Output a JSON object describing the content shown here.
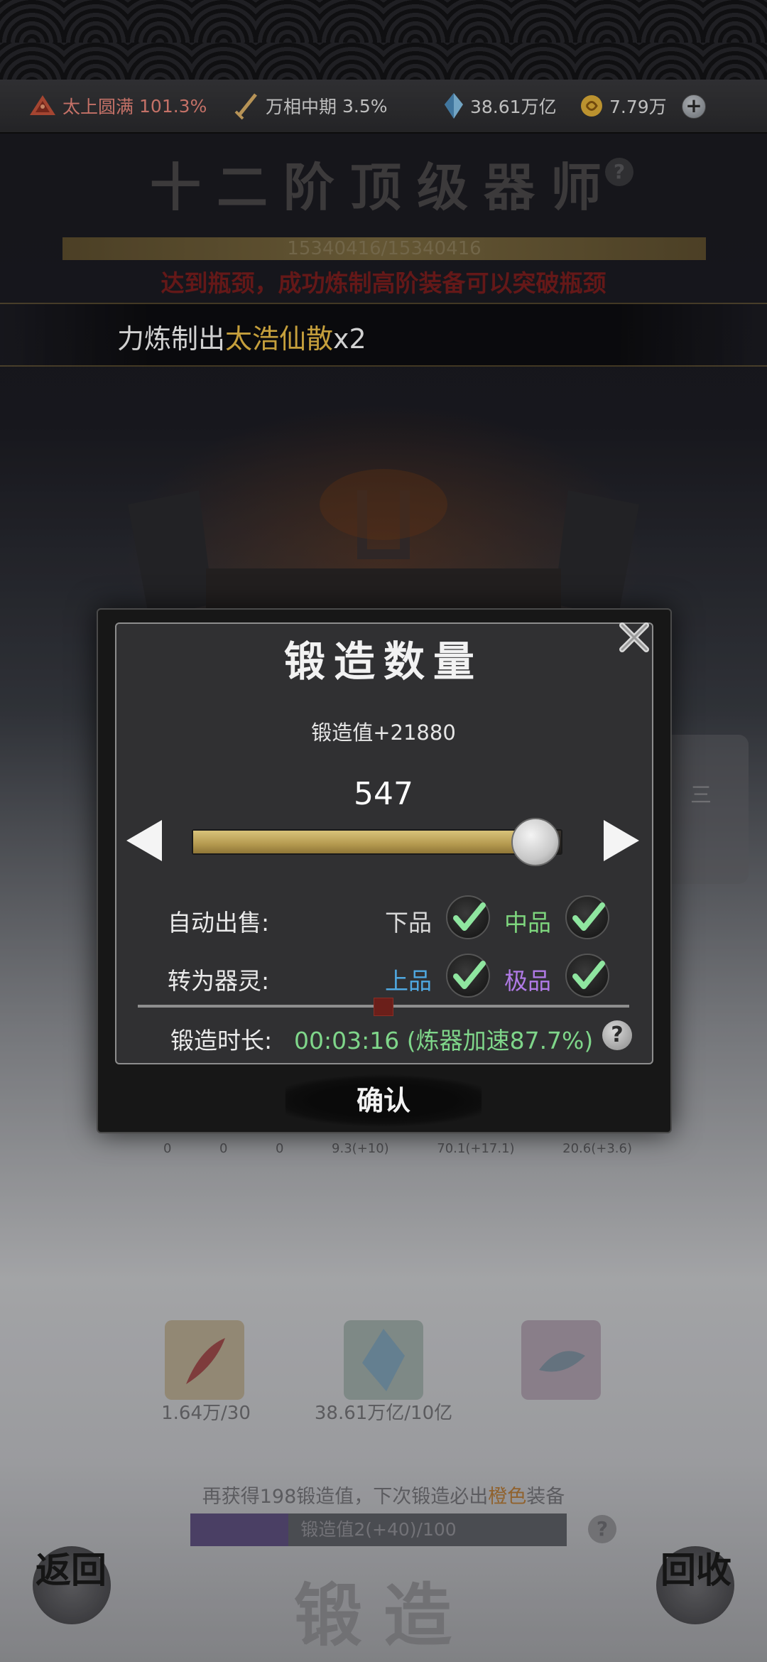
{
  "resources": {
    "realm1": {
      "name": "太上圆满",
      "value": "101.3%"
    },
    "realm2": {
      "name": "万相中期",
      "value": "3.5%"
    },
    "crystal": "38.61万亿",
    "coin": "7.79万"
  },
  "background": {
    "title": "十二阶顶级器师",
    "exp": "15340416/15340416",
    "bottleneck_msg": "达到瓶颈，成功炼制高阶装备可以突破瓶颈",
    "announce_prefix": "力炼制出",
    "announce_item": "太浩仙散",
    "announce_count": "x2",
    "side_icon": "三",
    "stats": [
      "0",
      "0",
      "0",
      "9.3(+10)",
      "70.1(+17.1)",
      "20.6(+3.6)"
    ],
    "materials": [
      {
        "icon": "feather-icon",
        "count": "1.64万/30"
      },
      {
        "icon": "crystal-icon",
        "count": "38.61万亿/10亿"
      },
      {
        "icon": "fish-icon",
        "count": ""
      }
    ],
    "guarantee_prefix": "再获得198锻造值，下次锻造必出",
    "guarantee_color": "橙色",
    "guarantee_suffix": "装备",
    "progress_text": "锻造值2(+40)/100",
    "progress_fraction": 0.26,
    "forge_button": "锻造",
    "back_button": "返回",
    "recycle_button": "回收"
  },
  "dialog": {
    "title": "锻造数量",
    "forge_value": "锻造值+21880",
    "quantity": "547",
    "slider_fraction": 0.93,
    "auto_sell_label": "自动出售:",
    "to_spirit_label": "转为器灵:",
    "grades": {
      "low": {
        "name": "下品",
        "color": "#d8d8d8",
        "checked": true
      },
      "mid": {
        "name": "中品",
        "color": "#7ed67e",
        "checked": true
      },
      "high": {
        "name": "上品",
        "color": "#4fa8e0",
        "checked": true
      },
      "top": {
        "name": "极品",
        "color": "#b07ae6",
        "checked": true
      }
    },
    "duration_label": "锻造时长:",
    "duration_value": "00:03:16 (炼器加速87.7%)",
    "help": "?",
    "confirm": "确认"
  }
}
